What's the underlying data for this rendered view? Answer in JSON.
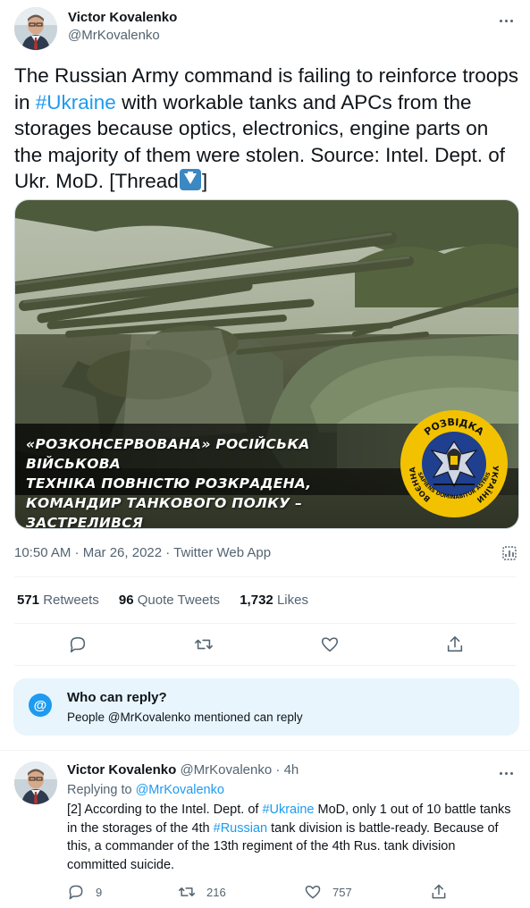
{
  "tweet": {
    "author": {
      "name": "Victor Kovalenko",
      "handle": "@MrKovalenko"
    },
    "text_parts": [
      "The Russian Army command is failing to reinforce troops in ",
      "#Ukraine",
      " with workable tanks and APCs from the storages because optics, electronics, engine parts on the majority of them were stolen. Source: Intel. Dept. of Ukr. MoD. [Thread",
      "]"
    ],
    "media": {
      "caption_lines": [
        "«РОЗКОНСЕРВОВАНА» РОСІЙСЬКА ВІЙСЬКОВА",
        "ТЕХНІКА ПОВНІСТЮ РОЗКРАДЕНА,",
        "КОМАНДИР ТАНКОВОГО ПОЛКУ – ЗАСТРЕЛИВСЯ"
      ],
      "emblem_text": {
        "top": "РОЗВІДКА",
        "left": "ВОЄННА",
        "right": "УКРАЇНИ",
        "bottom": "SAPIENS DOMINABITUR ASTRIS"
      }
    },
    "timestamp": "10:50 AM · Mar 26, 2022 · Twitter Web App",
    "stats": {
      "retweets_count": "571",
      "retweets_label": "Retweets",
      "quotes_count": "96",
      "quotes_label": "Quote Tweets",
      "likes_count": "1,732",
      "likes_label": "Likes"
    },
    "icons": [
      "more-icon",
      "analytics-icon",
      "reply-icon",
      "retweet-icon",
      "like-icon",
      "share-icon",
      "arrow-down-emoji"
    ]
  },
  "who_can_reply": {
    "symbol": "@",
    "title": "Who can reply?",
    "description": "People @MrKovalenko mentioned can reply"
  },
  "reply_tweet": {
    "author": {
      "name": "Victor Kovalenko",
      "handle": "@MrKovalenko",
      "time": "4h",
      "dot": "·"
    },
    "replying_prefix": "Replying to ",
    "replying_to": "@MrKovalenko",
    "text_parts": [
      "[2] According to the Intel. Dept. of ",
      "#Ukraine",
      " MoD, only 1 out of 10 battle tanks in the storages of the 4th ",
      "#Russian",
      " tank division is battle-ready. Because of this, a commander of the 13th regiment of the 4th Rus. tank division committed suicide."
    ],
    "counts": {
      "replies": "9",
      "retweets": "216",
      "likes": "757"
    }
  },
  "colors": {
    "accent": "#1d9bf0",
    "text": "#0f1419",
    "muted": "#536471",
    "reply_bg": "#e8f5fd",
    "divider": "#eff3f4"
  }
}
